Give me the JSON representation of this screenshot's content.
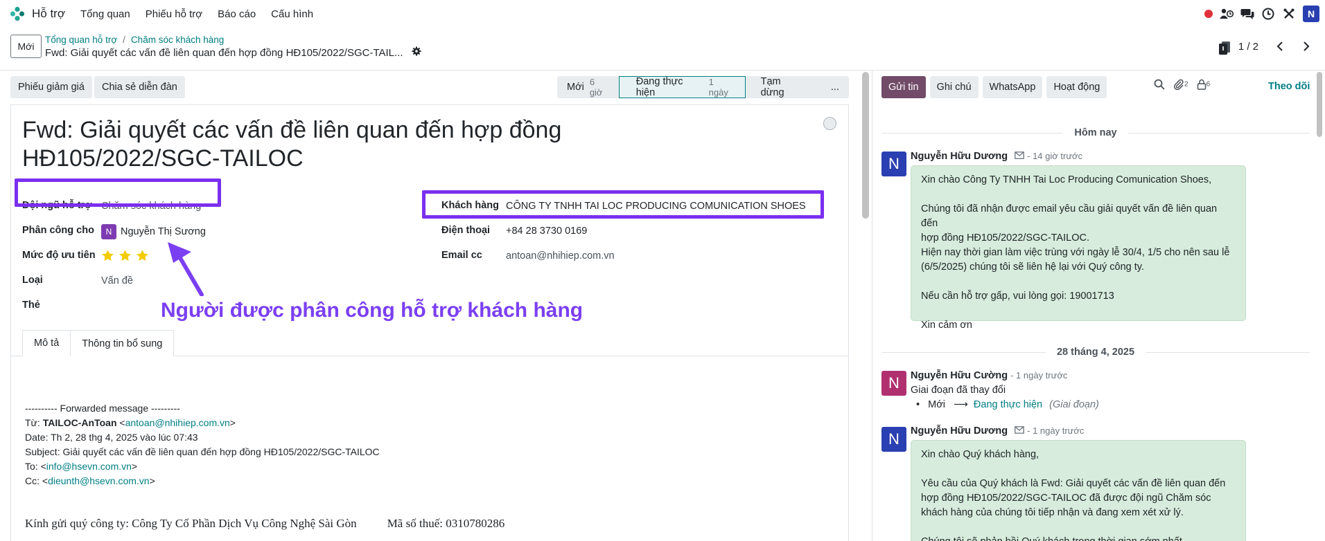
{
  "navbar": {
    "app_name": "Hỗ trợ",
    "menu": [
      "Tổng quan",
      "Phiếu hỗ trợ",
      "Báo cáo",
      "Cấu hình"
    ],
    "user_initial": "N",
    "brand_color": "#017e84"
  },
  "control": {
    "new_label": "Mới",
    "breadcrumb": [
      "Tổng quan hỗ trợ",
      "Chăm sóc khách hàng"
    ],
    "breadcrumb_sep": "/",
    "record_title": "Fwd: Giải quyết các vấn đề liên quan đến hợp đồng HĐ105/2022/SGC-TAIL...",
    "pager": "1 / 2"
  },
  "actions": {
    "coupon": "Phiếu giảm giá",
    "share_forum": "Chia sẻ diễn đàn"
  },
  "stages": [
    {
      "name": "Mới",
      "duration": "6 giờ"
    },
    {
      "name": "Đang thực hiện",
      "duration": "1 ngày"
    },
    {
      "name": "Tạm dừng",
      "duration": ""
    },
    {
      "name": "...",
      "duration": ""
    }
  ],
  "form": {
    "title": "Fwd: Giải quyết các vấn đề liên quan đến hợp đồng HĐ105/2022/SGC-TAILOC",
    "team_label": "Đội ngũ hỗ trợ",
    "team_value": "Chăm sóc khách hàng",
    "assign_label": "Phân công cho",
    "assign_initial": "N",
    "assign_value": "Nguyễn Thị Sương",
    "priority_label": "Mức độ ưu tiên",
    "priority_stars": 3,
    "type_label": "Loại",
    "type_value": "Vấn đề",
    "tags_label": "Thẻ",
    "customer_label": "Khách hàng",
    "customer_value": "CÔNG TY TNHH TAI LOC PRODUCING COMUNICATION SHOES",
    "phone_label": "Điện thoại",
    "phone_value": "+84 28 3730 0169",
    "emailcc_label": "Email cc",
    "emailcc_value": "antoan@nhihiep.com.vn",
    "annotation": "Người được phân công hỗ trợ khách hàng",
    "highlight_color": "#7b2ff0"
  },
  "tabs": [
    "Mô tả",
    "Thông tin bổ sung"
  ],
  "email": {
    "forward_header": "---------- Forwarded message ---------",
    "from_prefix": "Từ: ",
    "from_name": "TAILOC-AnToan",
    "from_email": "antoan@nhihiep.com.vn",
    "date": "Date: Th 2, 28 thg 4, 2025 vào lúc 07:43",
    "subject": "Subject: Giải quyết các vấn đề liên quan đến hợp đồng HĐ105/2022/SGC-TAILOC",
    "to_prefix": "To: <",
    "to_email": "info@hsevn.com.vn",
    "cc_prefix": "Cc: <",
    "cc_email": "dieunth@hsevn.com.vn",
    "letter_greeting": "Kính gửi quý công ty: Công Ty Cổ Phần Dịch Vụ Công Nghệ Sài Gòn",
    "letter_tax": "Mã số thuế: 0310780286"
  },
  "chatter": {
    "send": "Gửi tin",
    "note": "Ghi chú",
    "whatsapp": "WhatsApp",
    "activity": "Hoạt động",
    "attach_count": "2",
    "follower_count": "6",
    "follow": "Theo dõi",
    "today": "Hôm nay",
    "date2": "28 tháng 4, 2025",
    "messages": [
      {
        "author": "Nguyễn Hữu Dương",
        "time": "- 14 giờ trước",
        "initial": "N",
        "lines": [
          "Xin chào Công Ty TNHH Tai Loc Producing Comunication Shoes,",
          "",
          "Chúng tôi đã nhận được email yêu cầu giải quyết vấn đề liên quan đến",
          "hợp đồng HĐ105/2022/SGC-TAILOC.",
          "Hiện nay thời gian làm việc trùng với ngày lễ 30/4, 1/5 cho nên sau lễ",
          "(6/5/2025) chúng tôi sẽ liên hệ lại với Quý công ty.",
          "",
          "Nếu cần hỗ trợ gấp, vui lòng gọi: 19001713",
          "",
          "Xin cảm ơn"
        ]
      },
      {
        "author": "Nguyễn Hữu Cường",
        "time": "- 1 ngày trước",
        "initial": "N",
        "tracking_title": "Giai đoạn đã thay đổi",
        "tracking_old": "Mới",
        "tracking_new": "Đang thực hiện",
        "tracking_field": "(Giai đoạn)"
      },
      {
        "author": "Nguyễn Hữu Dương",
        "time": "- 1 ngày trước",
        "initial": "N",
        "lines": [
          "Xin chào Quý khách hàng,",
          "",
          "Yêu cầu của Quý khách là Fwd: Giải quyết các vấn đề liên quan đến",
          "hợp đồng HĐ105/2022/SGC-TAILOC đã được đội ngũ Chăm sóc",
          "khách hàng của chúng tôi tiếp nhận và đang xem xét xử lý.",
          "",
          "Chúng tôi sẽ phản hồi Quý khách trong thời gian sớm nhất"
        ]
      }
    ]
  }
}
